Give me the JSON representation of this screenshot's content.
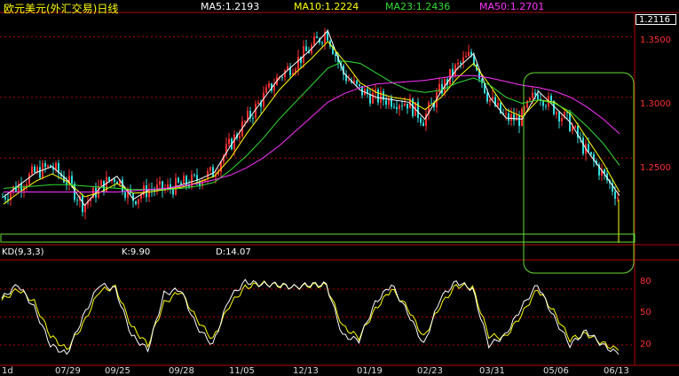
{
  "header": {
    "title": "欧元美元(外汇交易)日线",
    "ma5": "MA5:1.2193",
    "ma10": "MA10:1.2224",
    "ma23": "MA23:1.2436",
    "ma50": "MA50:1.2701"
  },
  "price_axis": {
    "last_price": "1.2116",
    "ticks": [
      "1.3500",
      "1.3000",
      "1.2500"
    ]
  },
  "kd_panel": {
    "name": "KD(9,3,3)",
    "k": "K:9.90",
    "d": "D:14.07",
    "ticks": [
      "80",
      "50",
      "20"
    ]
  },
  "x_axis": {
    "ticks": [
      "1d",
      "07/29",
      "09/25",
      "09/28",
      "11/05",
      "12/13",
      "01/19",
      "02/23",
      "03/31",
      "05/06",
      "06/13"
    ]
  },
  "colors": {
    "up": "#ff3030",
    "down": "#33dddd",
    "ma5": "#ffffff",
    "ma10": "#ffff00",
    "ma23": "#33dd33",
    "ma50": "#ff33ff",
    "grid": "#b00000",
    "annotation": "#66dd33"
  },
  "chart_data": {
    "type": "candlestick",
    "ylim": [
      1.18,
      1.37
    ],
    "series": [
      {
        "name": "MA5",
        "values": [
          1.218,
          1.228,
          1.238,
          1.243,
          1.231,
          1.211,
          1.226,
          1.235,
          1.216,
          1.224,
          1.224,
          1.228,
          1.232,
          1.238,
          1.26,
          1.28,
          1.298,
          1.316,
          1.328,
          1.34,
          1.355,
          1.32,
          1.306,
          1.3,
          1.298,
          1.296,
          1.282,
          1.305,
          1.324,
          1.336,
          1.3,
          1.283,
          1.282,
          1.305,
          1.292,
          1.279,
          1.256,
          1.238,
          1.219
        ]
      },
      {
        "name": "MA10",
        "values": [
          1.212,
          1.222,
          1.231,
          1.237,
          1.23,
          1.218,
          1.222,
          1.229,
          1.221,
          1.222,
          1.224,
          1.226,
          1.23,
          1.235,
          1.25,
          1.27,
          1.288,
          1.306,
          1.32,
          1.332,
          1.346,
          1.33,
          1.312,
          1.304,
          1.3,
          1.298,
          1.29,
          1.3,
          1.316,
          1.328,
          1.31,
          1.29,
          1.284,
          1.298,
          1.296,
          1.286,
          1.266,
          1.246,
          1.222
        ]
      },
      {
        "name": "MA23",
        "values": [
          1.225,
          1.226,
          1.227,
          1.228,
          1.228,
          1.227,
          1.226,
          1.225,
          1.224,
          1.224,
          1.224,
          1.225,
          1.227,
          1.23,
          1.24,
          1.252,
          1.266,
          1.282,
          1.296,
          1.31,
          1.324,
          1.33,
          1.328,
          1.32,
          1.312,
          1.306,
          1.304,
          1.306,
          1.312,
          1.316,
          1.31,
          1.3,
          1.295,
          1.298,
          1.295,
          1.288,
          1.276,
          1.262,
          1.244
        ]
      },
      {
        "name": "MA50",
        "values": [
          1.222,
          1.222,
          1.222,
          1.222,
          1.222,
          1.222,
          1.222,
          1.222,
          1.223,
          1.224,
          1.225,
          1.227,
          1.229,
          1.232,
          1.236,
          1.242,
          1.25,
          1.26,
          1.272,
          1.284,
          1.296,
          1.303,
          1.308,
          1.311,
          1.312,
          1.313,
          1.314,
          1.316,
          1.318,
          1.318,
          1.316,
          1.313,
          1.31,
          1.308,
          1.305,
          1.3,
          1.292,
          1.282,
          1.27
        ]
      }
    ],
    "kd": {
      "ylim": [
        0,
        100
      ],
      "k": [
        70,
        85,
        60,
        20,
        10,
        50,
        85,
        80,
        30,
        15,
        75,
        80,
        40,
        20,
        70,
        88,
        85,
        85,
        82,
        85,
        85,
        30,
        25,
        65,
        85,
        55,
        20,
        70,
        88,
        80,
        20,
        30,
        60,
        85,
        50,
        20,
        35,
        20,
        10
      ],
      "d": [
        68,
        80,
        66,
        30,
        15,
        42,
        78,
        82,
        40,
        20,
        65,
        78,
        48,
        26,
        62,
        82,
        86,
        84,
        82,
        84,
        84,
        40,
        28,
        58,
        80,
        60,
        28,
        62,
        84,
        82,
        30,
        28,
        52,
        80,
        56,
        26,
        32,
        22,
        14
      ]
    }
  }
}
